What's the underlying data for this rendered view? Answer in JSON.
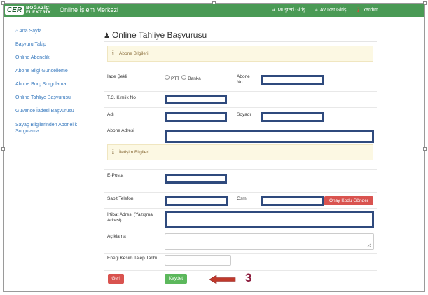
{
  "header": {
    "logo_badge": "CER",
    "logo_line1": "BOĞAZİÇİ",
    "logo_line2": "ELEKTRİK",
    "brand": "Online İşlem Merkezi",
    "links": [
      {
        "icon": "sign-in-icon",
        "label": "Müşteri Giriş"
      },
      {
        "icon": "sign-in-icon",
        "label": "Avukat Giriş"
      },
      {
        "icon": "question-circle-icon",
        "label": "Yardım"
      }
    ]
  },
  "sidebar": {
    "items": [
      {
        "icon": "home-icon",
        "label": "Ana Sayfa"
      },
      {
        "label": "Başvuru Takip"
      },
      {
        "label": "Online Abonelik"
      },
      {
        "label": "Abone Bilgi Güncelleme"
      },
      {
        "label": "Abone Borç Sorgulama"
      },
      {
        "label": "Online Tahliye Başvurusu"
      },
      {
        "label": "Güvence İadesi Başvurusu"
      },
      {
        "label": "Sayaç Bilgilerinden Abonelik Sorgulama"
      }
    ]
  },
  "page": {
    "title": "Online Tahliye Başvurusu",
    "title_icon": "user-icon"
  },
  "form": {
    "section1": "Abone Bilgileri",
    "iade_sekli_label": "İade Şekli",
    "radio_ptt": "PTT",
    "radio_banka": "Banka",
    "abone_no_label": "Abone No",
    "tc_label": "T.C. Kimlik No",
    "adi_label": "Adı",
    "soyadi_label": "Soyadı",
    "abone_adresi_label": "Abone Adresi",
    "section2": "İletişim Bilgileri",
    "eposta_label": "E-Posta",
    "sabit_tel_label": "Sabit Telefon",
    "gsm_label": "Gsm",
    "onay_button": "Onay Kodu Gönder",
    "irtibat_label": "İrtibat Adresi (Yazışma Adresi)",
    "aciklama_label": "Açıklama",
    "enerji_label": "Enerji Kesim Talep Tarihi",
    "geri_button": "Geri",
    "kaydet_button": "Kaydet"
  },
  "annotation": {
    "step_number": "3",
    "arrow_color": "#c0392b"
  },
  "colors": {
    "navbar": "#4a9a55",
    "link": "#3a7bbf",
    "highlight_border": "#2f4a7d",
    "danger": "#d9534f",
    "success": "#5cb85c",
    "alert_bg": "#fcf8e3"
  }
}
